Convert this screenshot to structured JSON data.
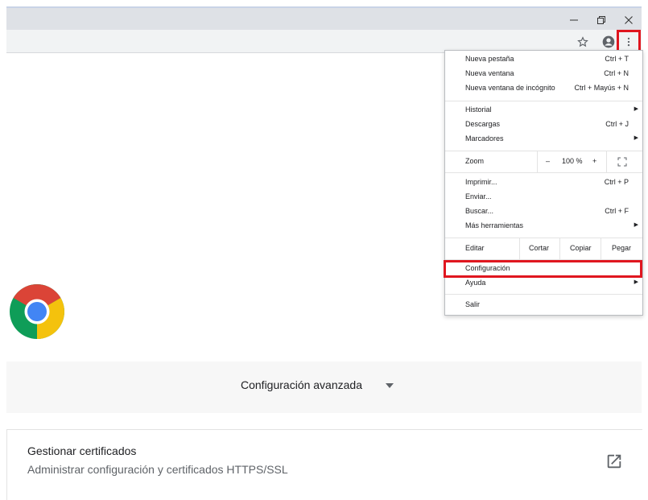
{
  "window": {
    "minimize_icon": "minimize-icon",
    "restore_icon": "restore-icon",
    "close_icon": "close-icon"
  },
  "toolbar": {
    "bookmark_icon": "star-icon",
    "profile_icon": "account-circle-icon",
    "menu_icon": "three-dots-vertical-icon"
  },
  "menu": {
    "items": {
      "new_tab": {
        "label": "Nueva pestaña",
        "shortcut": "Ctrl + T"
      },
      "new_window": {
        "label": "Nueva ventana",
        "shortcut": "Ctrl + N"
      },
      "incognito": {
        "label": "Nueva ventana de incógnito",
        "shortcut": "Ctrl + Mayús + N"
      },
      "history": {
        "label": "Historial"
      },
      "downloads": {
        "label": "Descargas",
        "shortcut": "Ctrl + J"
      },
      "bookmarks": {
        "label": "Marcadores"
      },
      "print": {
        "label": "Imprimir...",
        "shortcut": "Ctrl + P"
      },
      "send": {
        "label": "Enviar..."
      },
      "find": {
        "label": "Buscar...",
        "shortcut": "Ctrl + F"
      },
      "more_tools": {
        "label": "Más herramientas"
      },
      "settings": {
        "label": "Configuración"
      },
      "help": {
        "label": "Ayuda"
      },
      "exit": {
        "label": "Salir"
      }
    },
    "zoom": {
      "label": "Zoom",
      "minus": "–",
      "value": "100 %",
      "plus": "+"
    },
    "edit": {
      "label": "Editar",
      "cut": "Cortar",
      "copy": "Copiar",
      "paste": "Pegar"
    }
  },
  "page": {
    "advanced_label": "Configuración avanzada",
    "certificates": {
      "title": "Gestionar certificados",
      "subtitle": "Administrar configuración y certificados HTTPS/SSL"
    }
  },
  "colors": {
    "highlight": "#e0161f",
    "chrome_red": "#db4437",
    "chrome_yellow": "#f4c20d",
    "chrome_green": "#0f9d58",
    "chrome_blue": "#4285f4"
  }
}
